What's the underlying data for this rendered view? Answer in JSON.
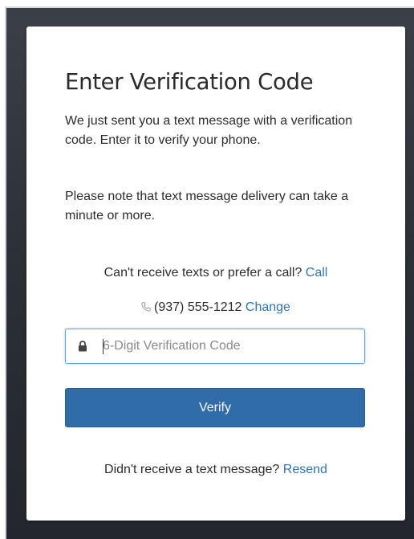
{
  "dialog": {
    "title": "Enter Verification Code",
    "message": "We just sent you a text message with a verification code. Enter it to verify your phone.",
    "note": "Please note that text message delivery can take a minute or more.",
    "call_prompt": "Can't receive texts or prefer a call?",
    "call_link": "Call",
    "phone_icon": "phone-icon",
    "phone_number": "(937) 555-1212",
    "change_link": "Change",
    "code_input": {
      "icon": "lock-icon",
      "placeholder": "6-Digit Verification Code",
      "value": ""
    },
    "verify_label": "Verify",
    "resend_prompt": "Didn't receive a text message?",
    "resend_link": "Resend"
  },
  "colors": {
    "backdrop": "#2b2f36",
    "link": "#2d74b8",
    "button": "#2f6ca8",
    "input_focus_border": "#66a6e0"
  }
}
